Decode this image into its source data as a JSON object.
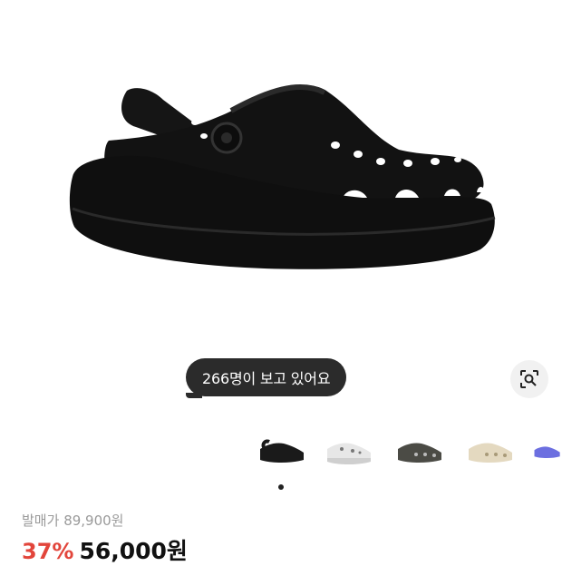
{
  "product": {
    "image_alt": "Black crush clog",
    "main_color": "#111111"
  },
  "viewers_badge": {
    "text": "266명이 보고 있어요"
  },
  "lens_button": {
    "icon": "lens-search-icon"
  },
  "color_options": [
    {
      "name": "black",
      "color": "#1a1a1a",
      "sole": "#1a1a1a"
    },
    {
      "name": "white-print",
      "color": "#e7e7e7",
      "sole": "#cfcfcf"
    },
    {
      "name": "dark-grey",
      "color": "#4b4b45",
      "sole": "#3a3a35"
    },
    {
      "name": "bone",
      "color": "#e4d9c0",
      "sole": "#d8cbaa"
    },
    {
      "name": "purple",
      "color": "#6c6fe0",
      "sole": "#5a5ed6"
    }
  ],
  "carousel": {
    "active_index": 0
  },
  "pricing": {
    "original_label": "발매가",
    "original_price": "89,900원",
    "discount": "37%",
    "sale_price": "56,000원",
    "discount_color": "#e2453b"
  }
}
